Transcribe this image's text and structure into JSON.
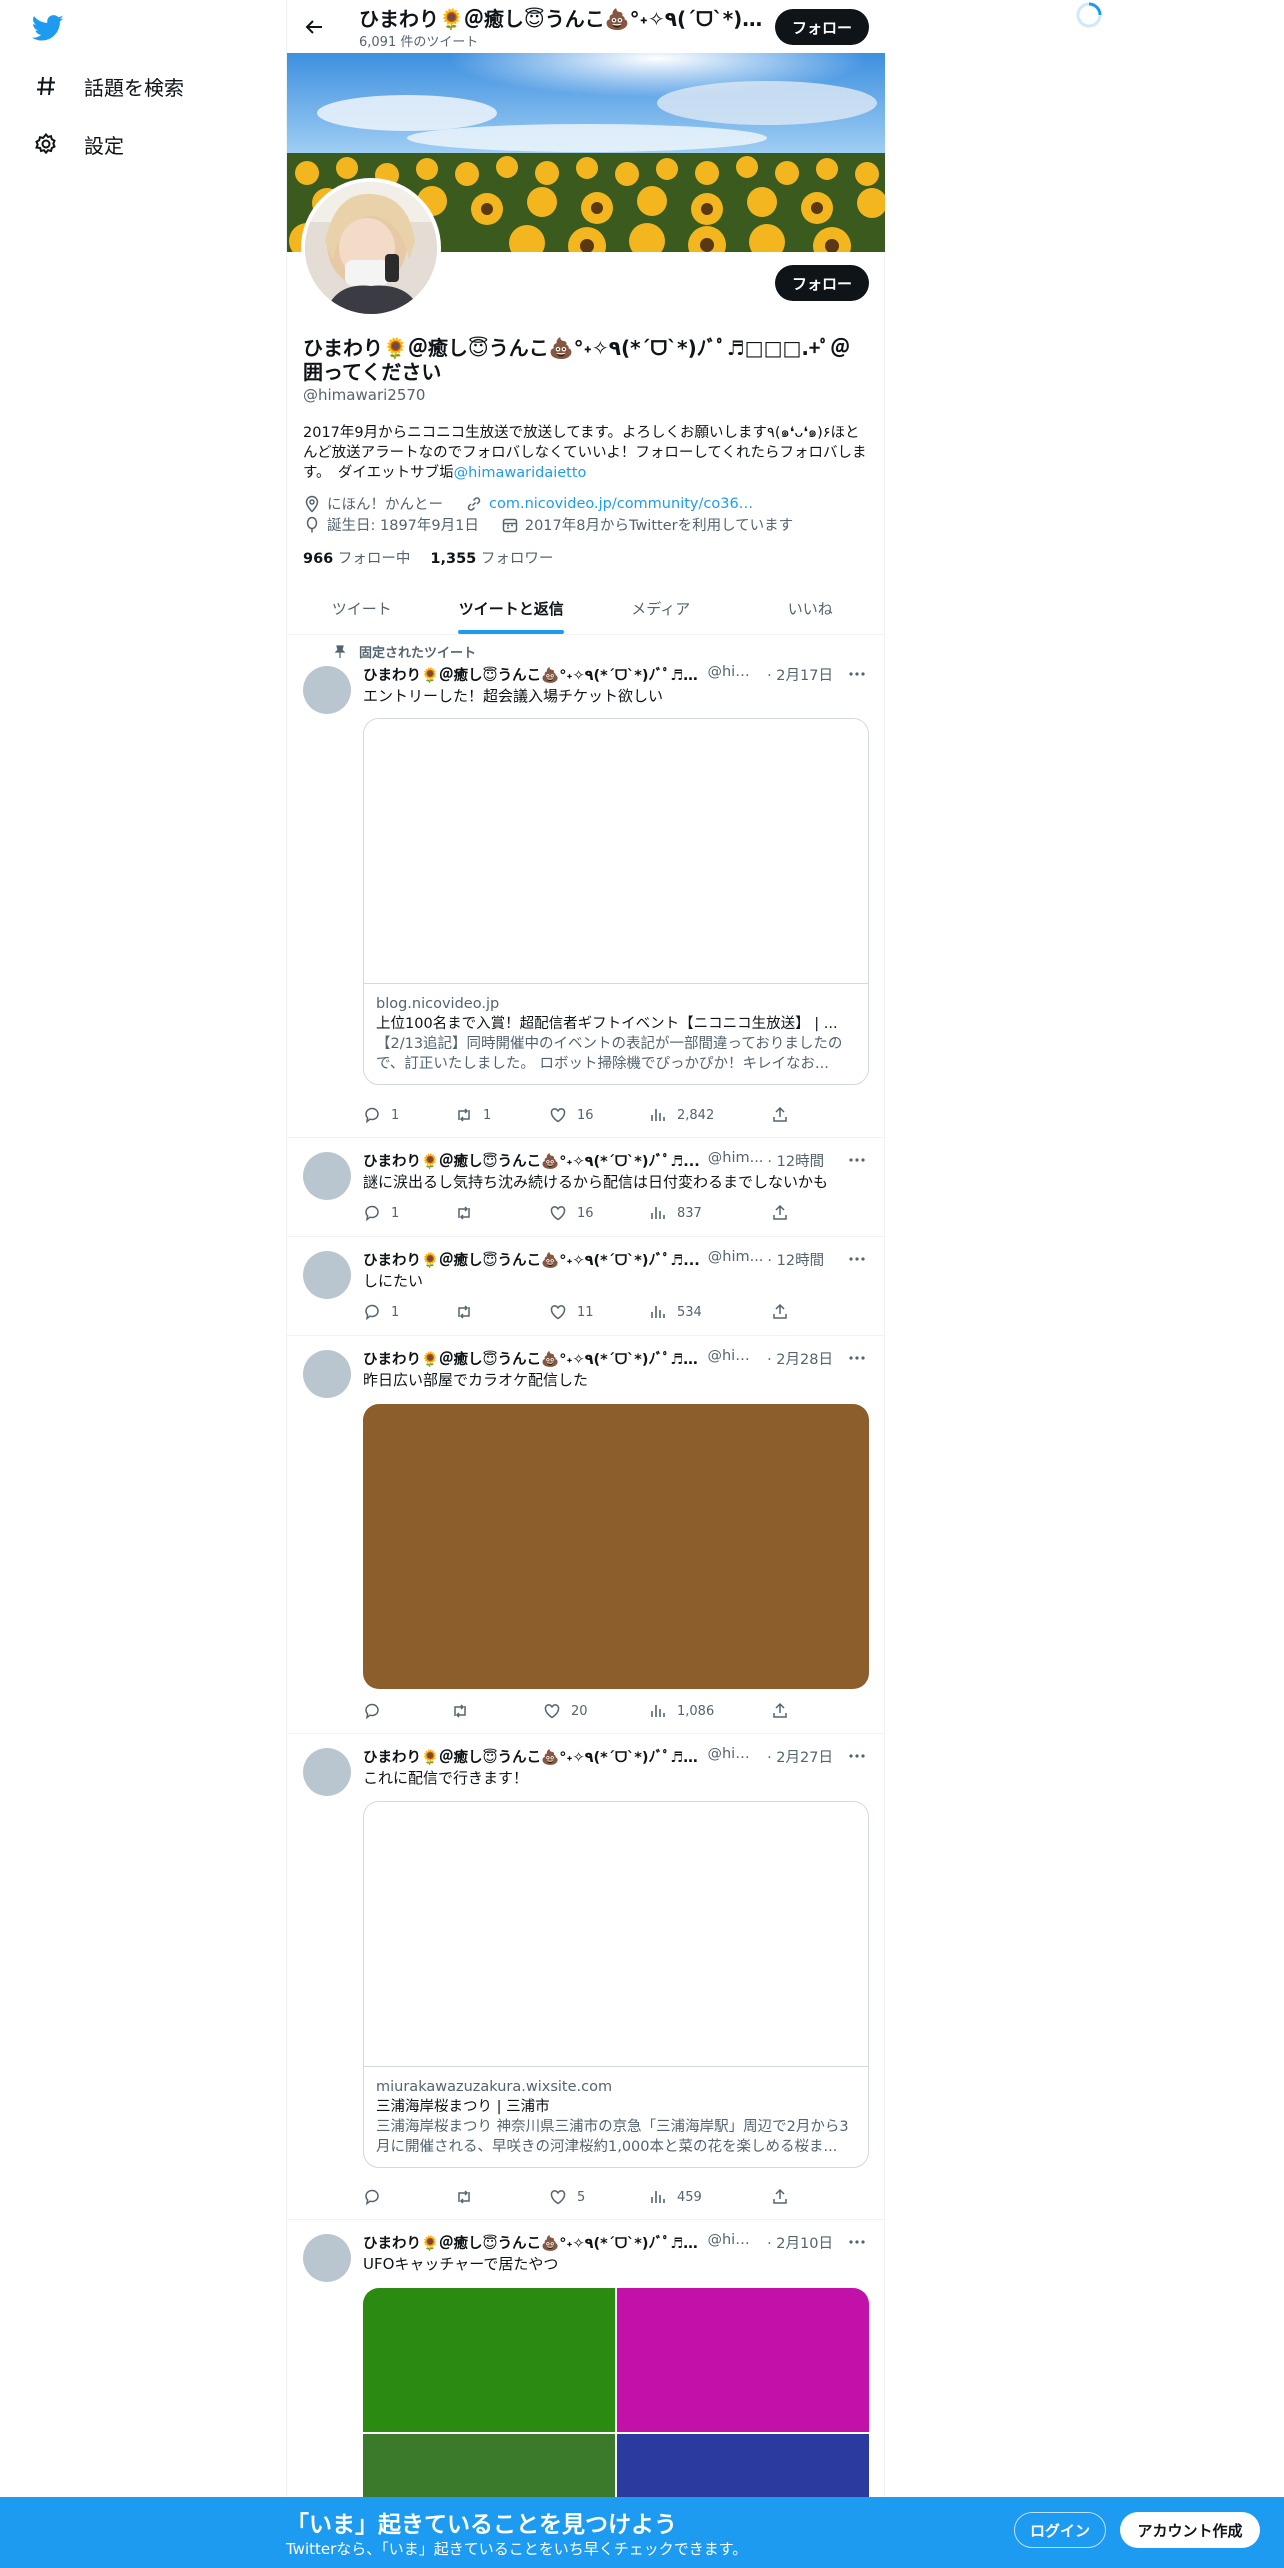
{
  "nav": {
    "explore_label": "話題を検索",
    "settings_label": "設定"
  },
  "header": {
    "title": "ひまわり🌻＠癒し😇うんこ💩°˖✧٩(ˊᗜˋ*)و✧˖°",
    "tweet_count": "6,091 件のツイート",
    "follow_label": "フォロー"
  },
  "profile": {
    "name": "ひまわり🌻＠癒し😇うんこ💩°˖✧٩(*ˊᗜˋ*)ﾉﾞﾟ♬□□□.+ﾟ＠囲ってください",
    "handle": "@himawari2570",
    "follow_label": "フォロー",
    "bio_text": "2017年9月からニコニコ生放送で放送してます。よろしくお願いします٩(๑❛ᴗ❛๑)۶ほとんど放送アラートなのでフォロバしなくていいよ！フォローしてくれたらフォロバします。　ダイエットサブ垢",
    "bio_mention": "@himawaridaietto",
    "location": "にほん！かんとー",
    "url": "com.nicovideo.jp/community/co36…",
    "birthday": "誕生日: 1897年9月1日",
    "joined": "2017年8月からTwitterを利用しています",
    "following_count": "966",
    "following_label": "フォロー中",
    "followers_count": "1,355",
    "followers_label": "フォロワー"
  },
  "tabs": [
    "ツイート",
    "ツイートと返信",
    "メディア",
    "いいね"
  ],
  "tweets": [
    {
      "pinned_label": "固定されたツイート",
      "name": "ひまわり🌻＠癒し😇うんこ💩°˖✧٩(*ˊᗜˋ*)ﾉﾞﾟ♬...",
      "handle": "@him...",
      "time": "· 2月17日",
      "text": "エントリーした！超会議入場チケット欲しい",
      "card": {
        "domain": "blog.nicovideo.jp",
        "title": "上位100名まで入賞！超配信者ギフトイベント【ニコニコ生放送】 | ...",
        "desc": "【2/13追記】同時開催中のイベントの表記が一部間違っておりましたので、訂正いたしました。 ロボット掃除機でぴっかぴか！キレイなお..."
      },
      "replies": "1",
      "retweets": "1",
      "likes": "16",
      "views": "2,842"
    },
    {
      "name": "ひまわり🌻＠癒し😇うんこ💩°˖✧٩(*ˊᗜˋ*)ﾉﾞﾟ♬...",
      "handle": "@him...",
      "time": "· 12時間",
      "text": "謎に涙出るし気持ち沈み続けるから配信は日付変わるまでしないかも",
      "replies": "1",
      "retweets": "",
      "likes": "16",
      "views": "837"
    },
    {
      "name": "ひまわり🌻＠癒し😇うんこ💩°˖✧٩(*ˊᗜˋ*)ﾉﾞﾟ♬...",
      "handle": "@him...",
      "time": "· 12時間",
      "text": "しにたい",
      "replies": "1",
      "retweets": "",
      "likes": "11",
      "views": "534"
    },
    {
      "name": "ひまわり🌻＠癒し😇うんこ💩°˖✧٩(*ˊᗜˋ*)ﾉﾞﾟ♬...",
      "handle": "@him...",
      "time": "· 2月28日",
      "text": "昨日広い部屋でカラオケ配信した",
      "media_color": "#8b5e2b",
      "replies": "",
      "retweets": "",
      "likes": "20",
      "views": "1,086"
    },
    {
      "name": "ひまわり🌻＠癒し😇うんこ💩°˖✧٩(*ˊᗜˋ*)ﾉﾞﾟ♬...",
      "handle": "@him...",
      "time": "· 2月27日",
      "text": "これに配信で行きます！",
      "card": {
        "domain": "miurakawazuzakura.wixsite.com",
        "title": "三浦海岸桜まつり | 三浦市",
        "desc": "三浦海岸桜まつり 神奈川県三浦市の京急「三浦海岸駅」周辺で2月から3月に開催される、早咲きの河津桜約1,000本と菜の花を楽しめる桜ま..."
      },
      "replies": "",
      "retweets": "",
      "likes": "5",
      "views": "459"
    },
    {
      "name": "ひまわり🌻＠癒し😇うんこ💩°˖✧٩(*ˊᗜˋ*)ﾉﾞﾟ♬...",
      "handle": "@him...",
      "time": "· 2月10日",
      "text": "UFOキャッチャーで居たやつ",
      "media_colors": [
        "#2b8a12",
        "#c211a8",
        "#3a7a2a",
        "#2a3a9e"
      ]
    }
  ],
  "bottom_banner": {
    "title": "「いま」起きていることを見つけよう",
    "subtitle": "Twitterなら、「いま」起きていることをいち早くチェックできます。",
    "login_label": "ログイン",
    "signup_label": "アカウント作成"
  },
  "colors": {
    "accent": "#1d9bf0",
    "text": "#0f1419",
    "secondary": "#536471"
  }
}
